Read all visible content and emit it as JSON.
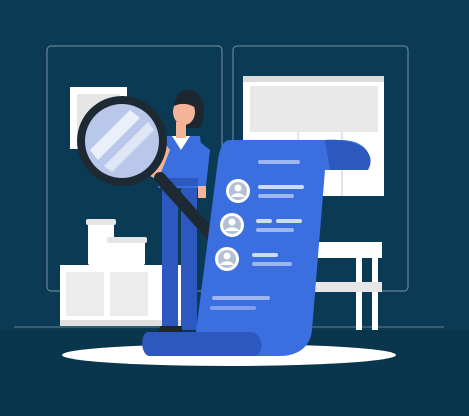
{
  "illustration": {
    "palette": {
      "background": "#0b3a55",
      "background_dark": "#093248",
      "accent_blue": "#3b6fe0",
      "accent_blue_dark": "#2c58c0",
      "white": "#ffffff",
      "shade": "#e6e6e6",
      "outline": "#1e2a33",
      "skin": "#f3b497",
      "hair": "#1e2630"
    },
    "icons": {
      "magnifier": "magnifying-glass-icon",
      "profile": "user-avatar-icon"
    },
    "list_rows": 3
  }
}
